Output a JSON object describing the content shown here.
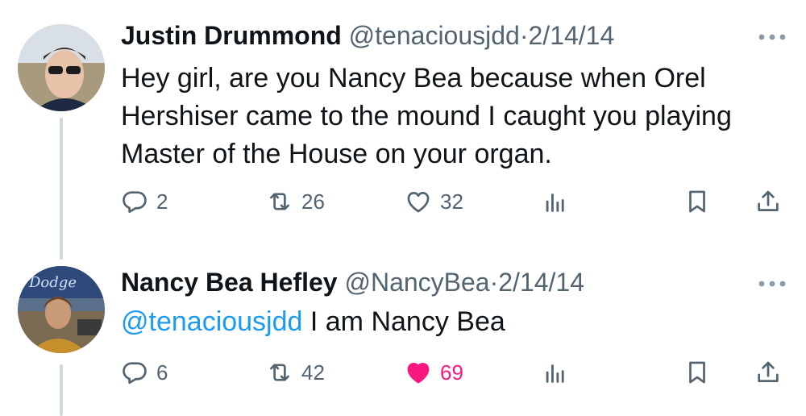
{
  "tweets": [
    {
      "author_name": "Justin Drummond",
      "handle": "@tenaciousjdd",
      "separator": "·",
      "date": "2/14/14",
      "text": "Hey girl, are you Nancy Bea because when Orel Hershiser came to the mound I caught you playing Master of the House on your organ.",
      "mention": "",
      "replies": "2",
      "retweets": "26",
      "likes": "32",
      "liked": false
    },
    {
      "author_name": "Nancy Bea Hefley",
      "handle": "@NancyBea",
      "separator": "·",
      "date": "2/14/14",
      "mention": "@tenaciousjdd",
      "text": " I am Nancy Bea",
      "replies": "6",
      "retweets": "42",
      "likes": "69",
      "liked": true
    }
  ],
  "colors": {
    "text": "#0f1419",
    "muted": "#536471",
    "link": "#1d9bf0",
    "like_active": "#f91880",
    "thread_line": "#cfd9de"
  },
  "icons": [
    "reply-icon",
    "retweet-icon",
    "like-icon",
    "views-icon",
    "bookmark-icon",
    "share-icon",
    "more-icon"
  ]
}
